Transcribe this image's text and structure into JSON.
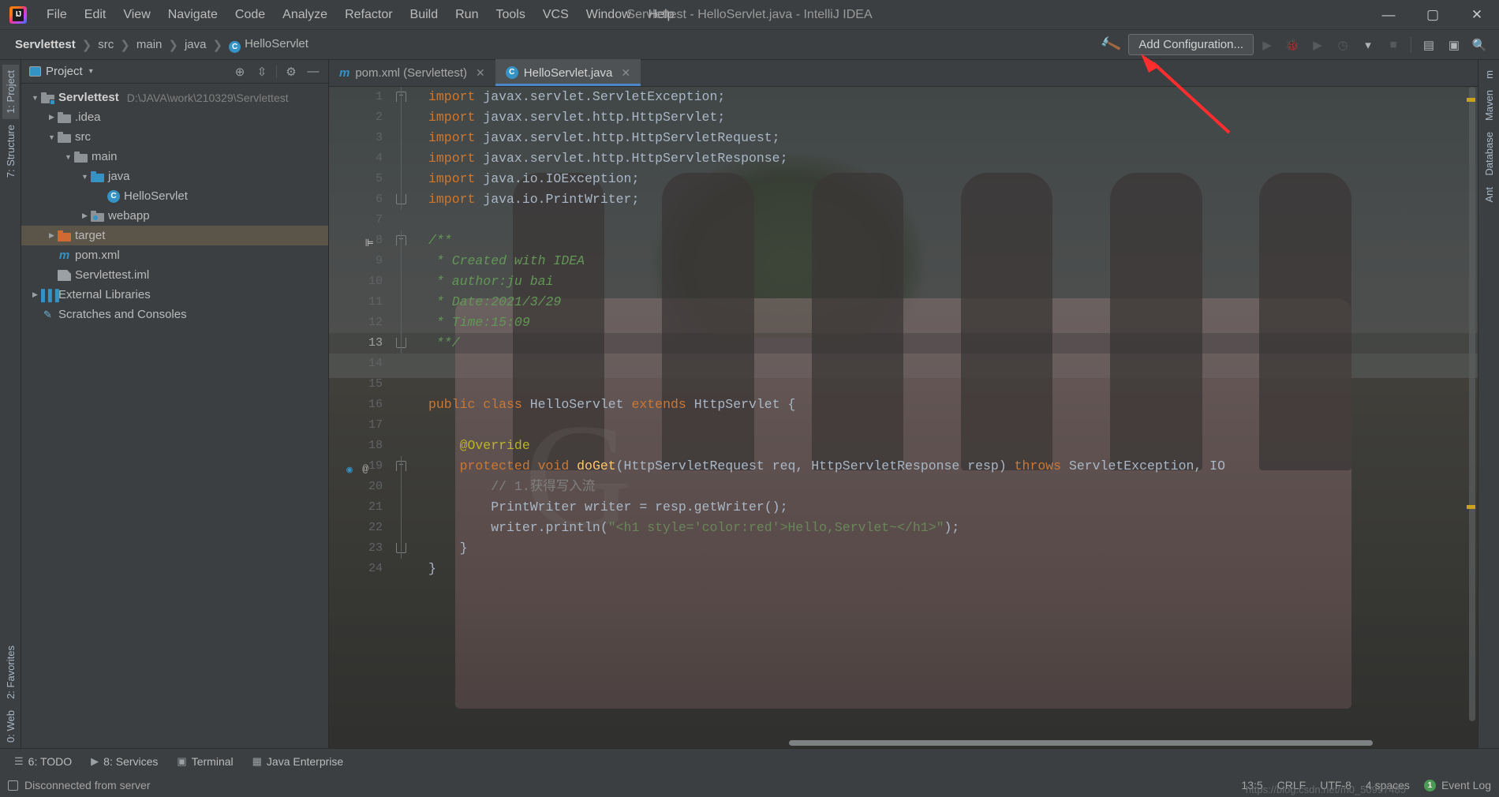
{
  "window": {
    "title": "Servlettest - HelloServlet.java - IntelliJ IDEA",
    "minimize": "—",
    "maximize": "▢",
    "close": "✕"
  },
  "menubar": [
    {
      "label": "File"
    },
    {
      "label": "Edit"
    },
    {
      "label": "View"
    },
    {
      "label": "Navigate"
    },
    {
      "label": "Code"
    },
    {
      "label": "Analyze"
    },
    {
      "label": "Refactor"
    },
    {
      "label": "Build"
    },
    {
      "label": "Run"
    },
    {
      "label": "Tools"
    },
    {
      "label": "VCS"
    },
    {
      "label": "Window"
    },
    {
      "label": "Help"
    }
  ],
  "breadcrumb": {
    "items": [
      "Servlettest",
      "src",
      "main",
      "java",
      "HelloServlet"
    ],
    "separator": "❯",
    "class_icon": "C"
  },
  "toolbar": {
    "build_icon": "🔨",
    "add_configuration": "Add Configuration...",
    "run_icon": "▶",
    "debug_icon": "🐞",
    "run_coverage_icon": "▶",
    "profile_icon": "◷",
    "dropdown_icon": "▾",
    "stop_icon": "■",
    "project_structure_icon": "▤",
    "layout_icon": "▣",
    "search_icon": "🔍"
  },
  "project_panel": {
    "title": "Project",
    "caret": "▾",
    "actions": [
      "locate-icon",
      "collapse-icon",
      "settings-icon",
      "hide-icon"
    ],
    "tree": [
      {
        "label": "Servlettest",
        "path": "D:\\JAVA\\work\\210329\\Servlettest",
        "icon": "module-folder",
        "arrow": "▼",
        "depth": 0,
        "bold": true,
        "selected": false
      },
      {
        "label": ".idea",
        "path": "",
        "icon": "folder",
        "arrow": "▶",
        "depth": 1,
        "bold": false,
        "selected": false
      },
      {
        "label": "src",
        "path": "",
        "icon": "folder",
        "arrow": "▼",
        "depth": 1,
        "bold": false,
        "selected": false
      },
      {
        "label": "main",
        "path": "",
        "icon": "folder",
        "arrow": "▼",
        "depth": 2,
        "bold": false,
        "selected": false
      },
      {
        "label": "java",
        "path": "",
        "icon": "source-folder",
        "arrow": "▼",
        "depth": 3,
        "bold": false,
        "selected": false
      },
      {
        "label": "HelloServlet",
        "path": "",
        "icon": "class",
        "arrow": "",
        "depth": 4,
        "bold": false,
        "selected": false
      },
      {
        "label": "webapp",
        "path": "",
        "icon": "web-folder",
        "arrow": "▶",
        "depth": 3,
        "bold": false,
        "selected": false
      },
      {
        "label": "target",
        "path": "",
        "icon": "excluded-folder",
        "arrow": "▶",
        "depth": 1,
        "bold": false,
        "selected": true
      },
      {
        "label": "pom.xml",
        "path": "",
        "icon": "maven",
        "arrow": "",
        "depth": 1,
        "bold": false,
        "selected": false
      },
      {
        "label": "Servlettest.iml",
        "path": "",
        "icon": "iml",
        "arrow": "",
        "depth": 1,
        "bold": false,
        "selected": false
      },
      {
        "label": "External Libraries",
        "path": "",
        "icon": "library",
        "arrow": "▶",
        "depth": 0,
        "bold": false,
        "selected": false
      },
      {
        "label": "Scratches and Consoles",
        "path": "",
        "icon": "scratch",
        "arrow": "",
        "depth": 0,
        "bold": false,
        "selected": false
      }
    ]
  },
  "left_strip": [
    {
      "label": "1: Project",
      "selected": true
    },
    {
      "label": "7: Structure",
      "selected": false
    },
    {
      "label": "2: Favorites",
      "selected": false
    },
    {
      "label": "0: Web",
      "selected": false
    }
  ],
  "right_strip": [
    {
      "label": "m",
      "selected": false
    },
    {
      "label": "Maven",
      "selected": false
    },
    {
      "label": "Database",
      "selected": false
    },
    {
      "label": "Ant",
      "selected": false
    }
  ],
  "editor": {
    "tabs": [
      {
        "label": "pom.xml (Servlettest)",
        "icon": "maven-icon",
        "active": false,
        "close": "✕"
      },
      {
        "label": "HelloServlet.java",
        "icon": "class-icon",
        "active": true,
        "close": "✕"
      }
    ],
    "lines": [
      {
        "n": 1,
        "fold": "start",
        "tokens": [
          {
            "t": "import ",
            "c": "k"
          },
          {
            "t": "javax.servlet.ServletException;",
            "c": "ty"
          }
        ]
      },
      {
        "n": 2,
        "fold": "",
        "tokens": [
          {
            "t": "import ",
            "c": "k"
          },
          {
            "t": "javax.servlet.http.HttpServlet;",
            "c": "ty"
          }
        ]
      },
      {
        "n": 3,
        "fold": "",
        "tokens": [
          {
            "t": "import ",
            "c": "k"
          },
          {
            "t": "javax.servlet.http.HttpServletRequest;",
            "c": "ty"
          }
        ]
      },
      {
        "n": 4,
        "fold": "",
        "tokens": [
          {
            "t": "import ",
            "c": "k"
          },
          {
            "t": "javax.servlet.http.HttpServletResponse;",
            "c": "ty"
          }
        ]
      },
      {
        "n": 5,
        "fold": "",
        "tokens": [
          {
            "t": "import ",
            "c": "k"
          },
          {
            "t": "java.io.IOException;",
            "c": "ty"
          }
        ]
      },
      {
        "n": 6,
        "fold": "end",
        "tokens": [
          {
            "t": "import ",
            "c": "k"
          },
          {
            "t": "java.io.PrintWriter;",
            "c": "ty"
          }
        ]
      },
      {
        "n": 7,
        "fold": "",
        "tokens": []
      },
      {
        "n": 8,
        "fold": "start",
        "override": "",
        "tokens": [
          {
            "t": "/**",
            "c": "cm"
          }
        ]
      },
      {
        "n": 9,
        "fold": "",
        "tokens": [
          {
            "t": " * Created with IDEA",
            "c": "cm"
          }
        ]
      },
      {
        "n": 10,
        "fold": "",
        "tokens": [
          {
            "t": " * author:ju bai",
            "c": "cm"
          }
        ]
      },
      {
        "n": 11,
        "fold": "",
        "tokens": [
          {
            "t": " * Date:2021/3/29",
            "c": "cm"
          }
        ]
      },
      {
        "n": 12,
        "fold": "",
        "tokens": [
          {
            "t": " * Time:15:09",
            "c": "cm"
          }
        ]
      },
      {
        "n": 13,
        "fold": "end",
        "current": true,
        "tokens": [
          {
            "t": " **/",
            "c": "cm"
          }
        ]
      },
      {
        "n": 14,
        "fold": "",
        "tokens": []
      },
      {
        "n": 15,
        "fold": "",
        "tokens": []
      },
      {
        "n": 16,
        "fold": "",
        "tokens": [
          {
            "t": "public class ",
            "c": "k"
          },
          {
            "t": "HelloServlet ",
            "c": "ty"
          },
          {
            "t": "extends ",
            "c": "k"
          },
          {
            "t": "HttpServlet {",
            "c": "ty"
          }
        ]
      },
      {
        "n": 17,
        "fold": "",
        "tokens": []
      },
      {
        "n": 18,
        "fold": "",
        "tokens": [
          {
            "t": "    @Override",
            "c": "an"
          }
        ]
      },
      {
        "n": 19,
        "fold": "start",
        "runmark": true,
        "atmark": "@",
        "tokens": [
          {
            "t": "    protected void ",
            "c": "k"
          },
          {
            "t": "doGet",
            "c": "fn"
          },
          {
            "t": "(HttpServletRequest req, HttpServletResponse resp) ",
            "c": "ty"
          },
          {
            "t": "throws ",
            "c": "k"
          },
          {
            "t": "ServletException, IO",
            "c": "ty"
          }
        ]
      },
      {
        "n": 20,
        "fold": "",
        "tokens": [
          {
            "t": "        // 1.获得写入流",
            "c": "cm2"
          }
        ]
      },
      {
        "n": 21,
        "fold": "",
        "tokens": [
          {
            "t": "        PrintWriter writer = resp.getWriter();",
            "c": "ty"
          }
        ]
      },
      {
        "n": 22,
        "fold": "",
        "tokens": [
          {
            "t": "        writer.println(",
            "c": "ty"
          },
          {
            "t": "\"<h1 style='color:red'>Hello,Servlet~</h1>\"",
            "c": "st"
          },
          {
            "t": ");",
            "c": "ty"
          }
        ]
      },
      {
        "n": 23,
        "fold": "end",
        "tokens": [
          {
            "t": "    }",
            "c": "ty"
          }
        ]
      },
      {
        "n": 24,
        "fold": "",
        "tokens": [
          {
            "t": "}",
            "c": "ty"
          }
        ]
      }
    ]
  },
  "bottom_toolbar": [
    {
      "label": "6: TODO",
      "icon": "list-icon"
    },
    {
      "label": "8: Services",
      "icon": "services-icon"
    },
    {
      "label": "Terminal",
      "icon": "terminal-icon"
    },
    {
      "label": "Java Enterprise",
      "icon": "java-enterprise-icon"
    }
  ],
  "statusbar": {
    "message": "Disconnected from server",
    "caret_position": "13:5",
    "line_separator": "CRLF",
    "encoding": "UTF-8",
    "indent": "4 spaces",
    "event_log": "Event Log",
    "event_badge": "1",
    "watermark": "https://blog.csdn.net/m0_50997485"
  }
}
